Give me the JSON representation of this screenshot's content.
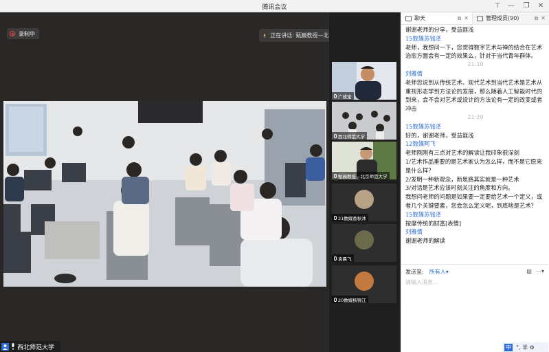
{
  "window": {
    "title": "腾讯会议"
  },
  "recording": {
    "label": "录制中"
  },
  "speaking": {
    "text": "正在讲话: 甄巍教授—北京师范..."
  },
  "main_video": {
    "name": "西北师范大学"
  },
  "thumbnails": [
    {
      "label": "广成宝",
      "kind": "video"
    },
    {
      "label": "西北师范大学",
      "kind": "video"
    },
    {
      "label": "甄巍教授—北京师范大学",
      "kind": "video"
    },
    {
      "label": "21数媒香秋沐",
      "kind": "avatar"
    },
    {
      "label": "袁晨飞",
      "kind": "avatar"
    },
    {
      "label": "20数媒杨锦江",
      "kind": "avatar"
    }
  ],
  "chat": {
    "tabs": [
      {
        "label": "聊天",
        "icon": "chat-icon"
      },
      {
        "label": "管理成员(90)",
        "icon": "members-icon"
      }
    ],
    "top_line": "谢谢老师的分享，受益匪浅",
    "messages": [
      {
        "name": "15数媒苏铭泽",
        "text": "老师，我想问一下，您觉得数字艺术与禅的结合在艺术治愈方面会有一定的效果么，针对于当代青年群体。",
        "time": "21:10"
      },
      {
        "name": "刘雅倩",
        "text": "老师您说到从传统艺术、现代艺术到当代艺术是艺术从重视形态学到方法论的发展，那么随着人工智能时代的到来，会不会对艺术或设计的方法论有一定的改变或者冲击",
        "time": "21:20"
      },
      {
        "name": "15数媒苏铭泽",
        "text": "好的，谢谢老师，受益匪浅",
        "time": ""
      },
      {
        "name": "12数媒阿飞",
        "text": "老师刚刚有三点对艺术的解读让我印象很深刻\n1/艺术作品重要的是艺术家认为怎么样，而不是它原来是什么样？\n2/发明一种新观念，新思路其实就是一种艺术\n3/对话是艺术应该时刻关注的角度和方向。\n我想问老师的问题是如果要一定要给艺术一个定义，或者几个关键要素，您会怎么定义呢，到底啥是艺术？",
        "time": ""
      },
      {
        "name": "15数媒苏铭泽",
        "text": "按摩传统的财富[表情]",
        "time": ""
      },
      {
        "name": "刘雅倩",
        "text": "谢谢老师的解读",
        "time": ""
      }
    ],
    "send_to_label": "发送至:",
    "send_to_value": "所有人▾",
    "input_placeholder": "请输入消息..."
  },
  "ime": {
    "mode": "中",
    "items": "°, 半 ⚙"
  }
}
